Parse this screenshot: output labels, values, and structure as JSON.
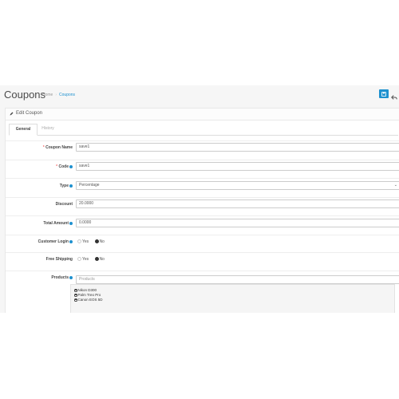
{
  "header": {
    "title": "Coupons",
    "breadcrumb": [
      "Home",
      "Coupons"
    ]
  },
  "panel": {
    "title": "Edit Coupon"
  },
  "tabs": [
    {
      "label": "General",
      "active": true
    },
    {
      "label": "History",
      "active": false
    }
  ],
  "form": {
    "coupon_name": {
      "label": "Coupon Name",
      "value": "save1"
    },
    "code": {
      "label": "Code",
      "value": "save1"
    },
    "type": {
      "label": "Type",
      "value": "Percentage"
    },
    "discount": {
      "label": "Discount",
      "value": "20.0000"
    },
    "total_amount": {
      "label": "Total Amount",
      "value": "0.0000"
    },
    "customer_login": {
      "label": "Customer Login",
      "yes": "Yes",
      "no": "No",
      "selected": "No"
    },
    "free_shipping": {
      "label": "Free Shipping",
      "yes": "Yes",
      "no": "No",
      "selected": "No"
    },
    "products": {
      "label": "Products",
      "placeholder": "Products",
      "items": [
        "Nikon D300",
        "Palm Treo Pro",
        "Canon EOS 5D"
      ]
    }
  },
  "colors": {
    "primary": "#1e91cf",
    "required": "#f56b6b"
  }
}
